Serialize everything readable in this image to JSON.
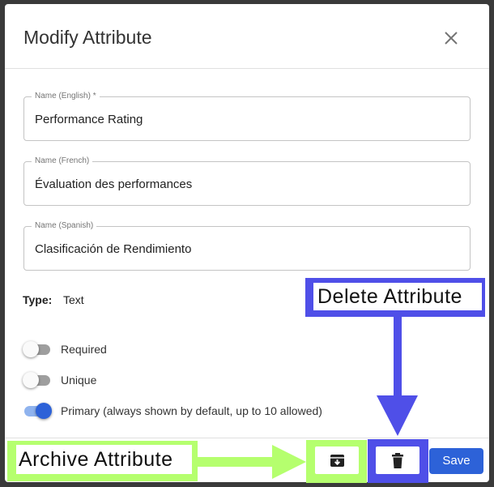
{
  "dialog": {
    "title": "Modify Attribute",
    "fields": [
      {
        "label": "Name (English) *",
        "value": "Performance Rating"
      },
      {
        "label": "Name (French)",
        "value": "Évaluation des performances"
      },
      {
        "label": "Name (Spanish)",
        "value": "Clasificación de Rendimiento"
      }
    ],
    "type": {
      "label": "Type:",
      "value": "Text"
    },
    "toggles": [
      {
        "label": "Required",
        "on": false
      },
      {
        "label": "Unique",
        "on": false
      },
      {
        "label": "Primary (always shown by default, up to 10 allowed)",
        "on": true
      }
    ],
    "save_label": "Save",
    "background_text": "Text"
  },
  "annotations": {
    "delete": "Delete Attribute",
    "archive": "Archive Attribute"
  },
  "colors": {
    "primary": "#2d62d8",
    "annotation_green": "#b5ff6e",
    "annotation_blue": "#4f4fe8"
  },
  "icons": {
    "close": "close-icon",
    "archive": "archive-icon",
    "delete": "trash-icon"
  }
}
